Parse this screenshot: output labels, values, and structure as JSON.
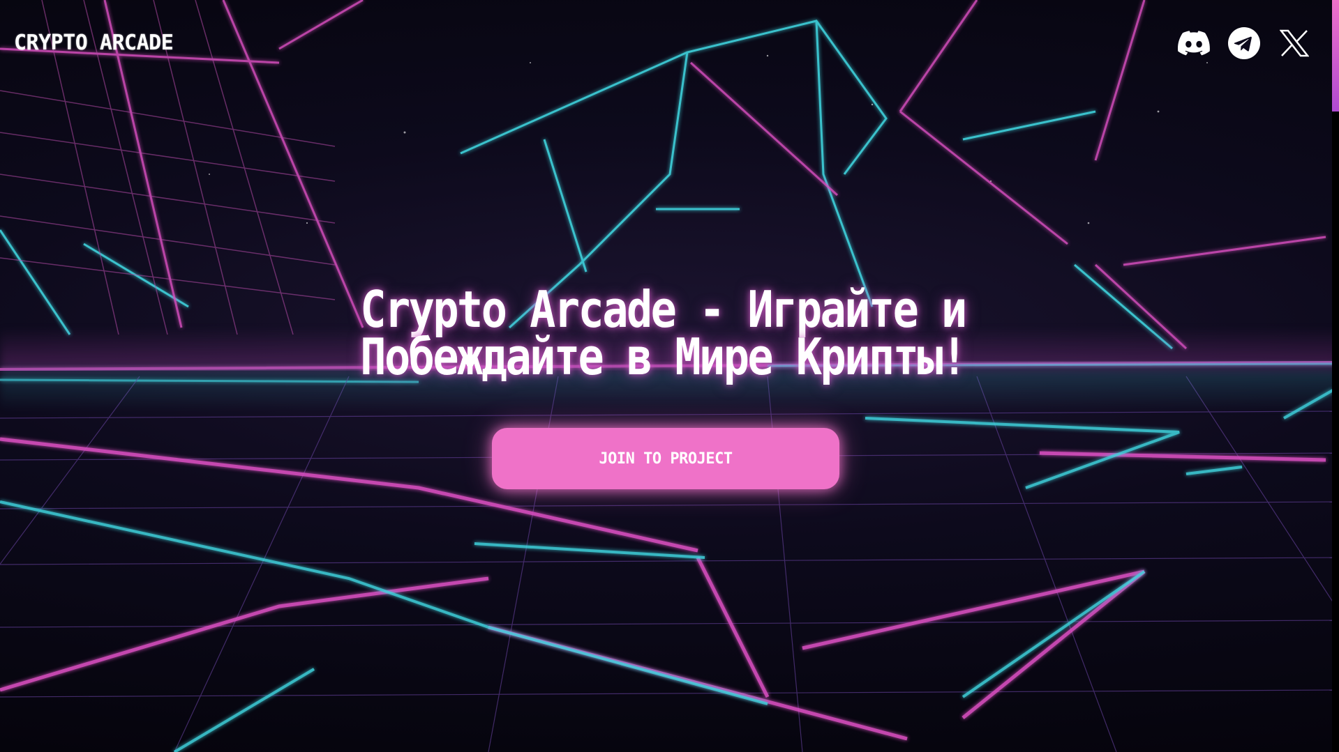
{
  "header": {
    "logo": "CRYPTO ARCADE",
    "socials": [
      {
        "name": "Discord",
        "icon": "discord-icon"
      },
      {
        "name": "Telegram",
        "icon": "telegram-icon"
      },
      {
        "name": "X",
        "icon": "x-icon"
      }
    ]
  },
  "hero": {
    "title_line1": "Crypto Arcade - Играйте и",
    "title_line2": "Побеждайте в Мире Крипты!",
    "cta_label": "JOIN TO PROJECT"
  },
  "colors": {
    "accent": "#ef72c8",
    "cyan": "#3fd6e0",
    "magenta": "#d94fc0",
    "background": "#07060f"
  }
}
